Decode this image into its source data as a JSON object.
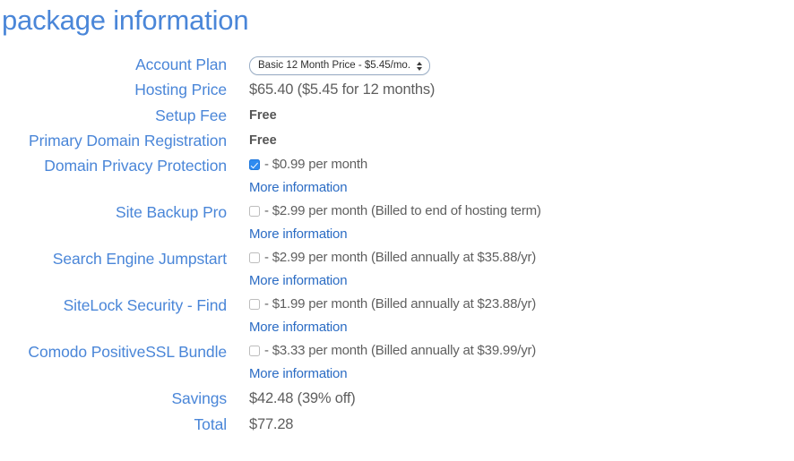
{
  "page": {
    "title": "package information"
  },
  "account_plan": {
    "label": "Account Plan",
    "selected_option": "Basic 12 Month Price - $5.45/mo.",
    "options": [
      "Basic 12 Month Price - $5.45/mo."
    ],
    "arrow_icon": "stepper-updown-icon"
  },
  "hosting_price": {
    "label": "Hosting Price",
    "value": "$65.40  ($5.45 for 12 months)"
  },
  "setup_fee": {
    "label": "Setup Fee",
    "value": "Free"
  },
  "primary_domain_registration": {
    "label": "Primary Domain Registration",
    "value": "Free"
  },
  "addons": [
    {
      "label": "Domain Privacy Protection",
      "checked": true,
      "price_text": "- $0.99 per month",
      "more_info_label": "More information"
    },
    {
      "label": "Site Backup Pro",
      "checked": false,
      "price_text": "- $2.99 per month (Billed to end of hosting term)",
      "more_info_label": "More information"
    },
    {
      "label": "Search Engine Jumpstart",
      "checked": false,
      "price_text": "- $2.99 per month (Billed annually at $35.88/yr)",
      "more_info_label": "More information"
    },
    {
      "label": "SiteLock Security - Find",
      "checked": false,
      "price_text": "- $1.99 per month (Billed annually at $23.88/yr)",
      "more_info_label": "More information"
    },
    {
      "label": "Comodo PositiveSSL Bundle",
      "checked": false,
      "price_text": "- $3.33 per month (Billed annually at $39.99/yr)",
      "more_info_label": "More information"
    }
  ],
  "savings": {
    "label": "Savings",
    "value": "$42.48 (39% off)"
  },
  "total": {
    "label": "Total",
    "value": "$77.28"
  },
  "colors": {
    "heading_blue": "#4a86d8",
    "label_blue": "#4a86d8",
    "link_blue": "#2b6cc4",
    "value_gray": "#5f5f5f",
    "checkbox_checked": "#2e8bf0",
    "background": "#ffffff"
  }
}
